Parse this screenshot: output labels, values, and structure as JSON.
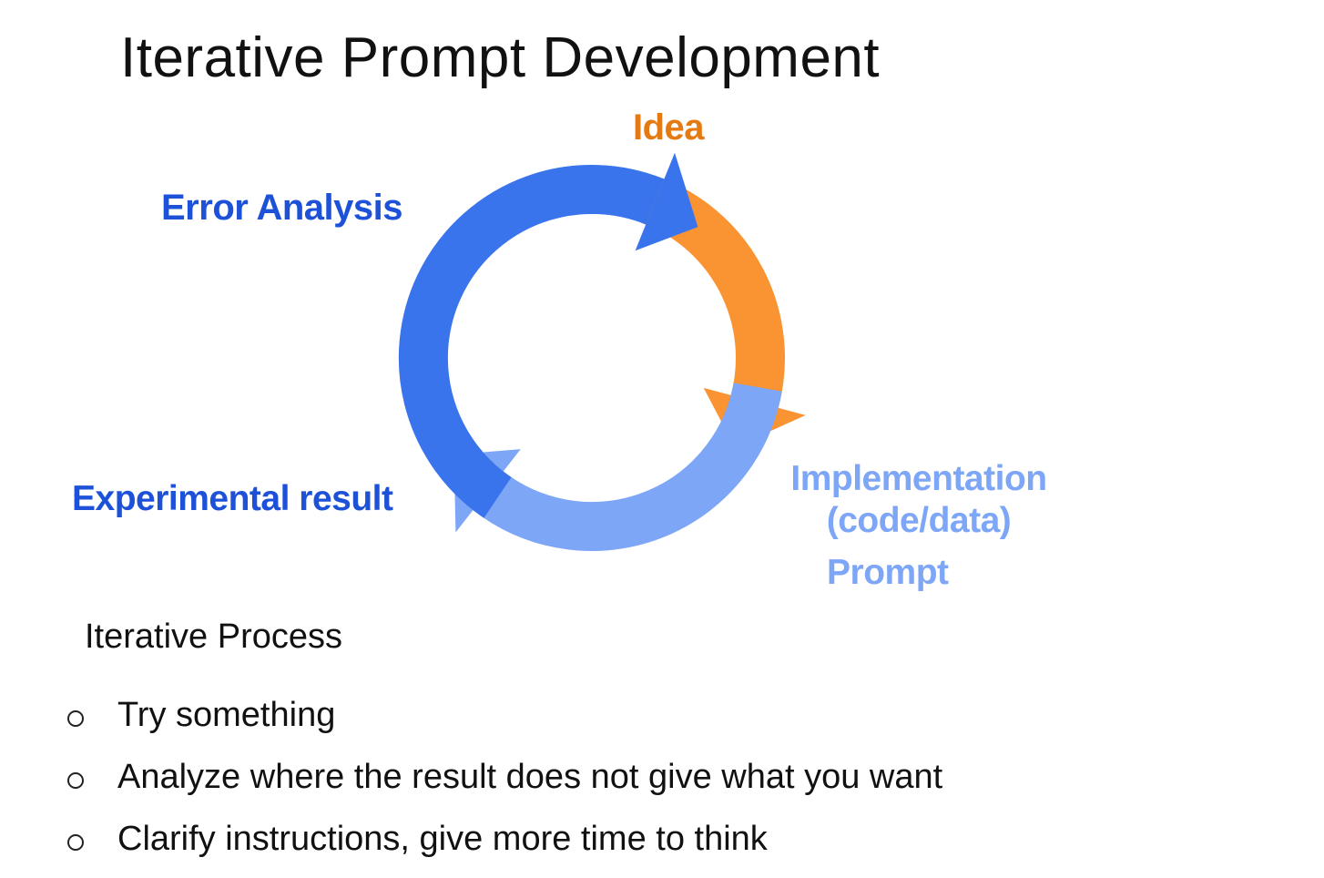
{
  "title": "Iterative Prompt Development",
  "cycle": {
    "stages": {
      "idea": "Idea",
      "implementation_line1": "Implementation",
      "implementation_line2": "(code/data)",
      "prompt": "Prompt",
      "experimental": "Experimental result",
      "error_analysis": "Error Analysis"
    },
    "colors": {
      "orange": "#FA9433",
      "light_blue": "#7EA6F6",
      "blue": "#3A74EC",
      "idea_text": "#E67A12",
      "dark_blue_text": "#1D52D8",
      "light_blue_text": "#7EA6F6"
    }
  },
  "process": {
    "heading": "Iterative Process",
    "items": [
      "Try something",
      "Analyze where the result does not give what you want",
      "Clarify instructions, give more time to think"
    ]
  }
}
